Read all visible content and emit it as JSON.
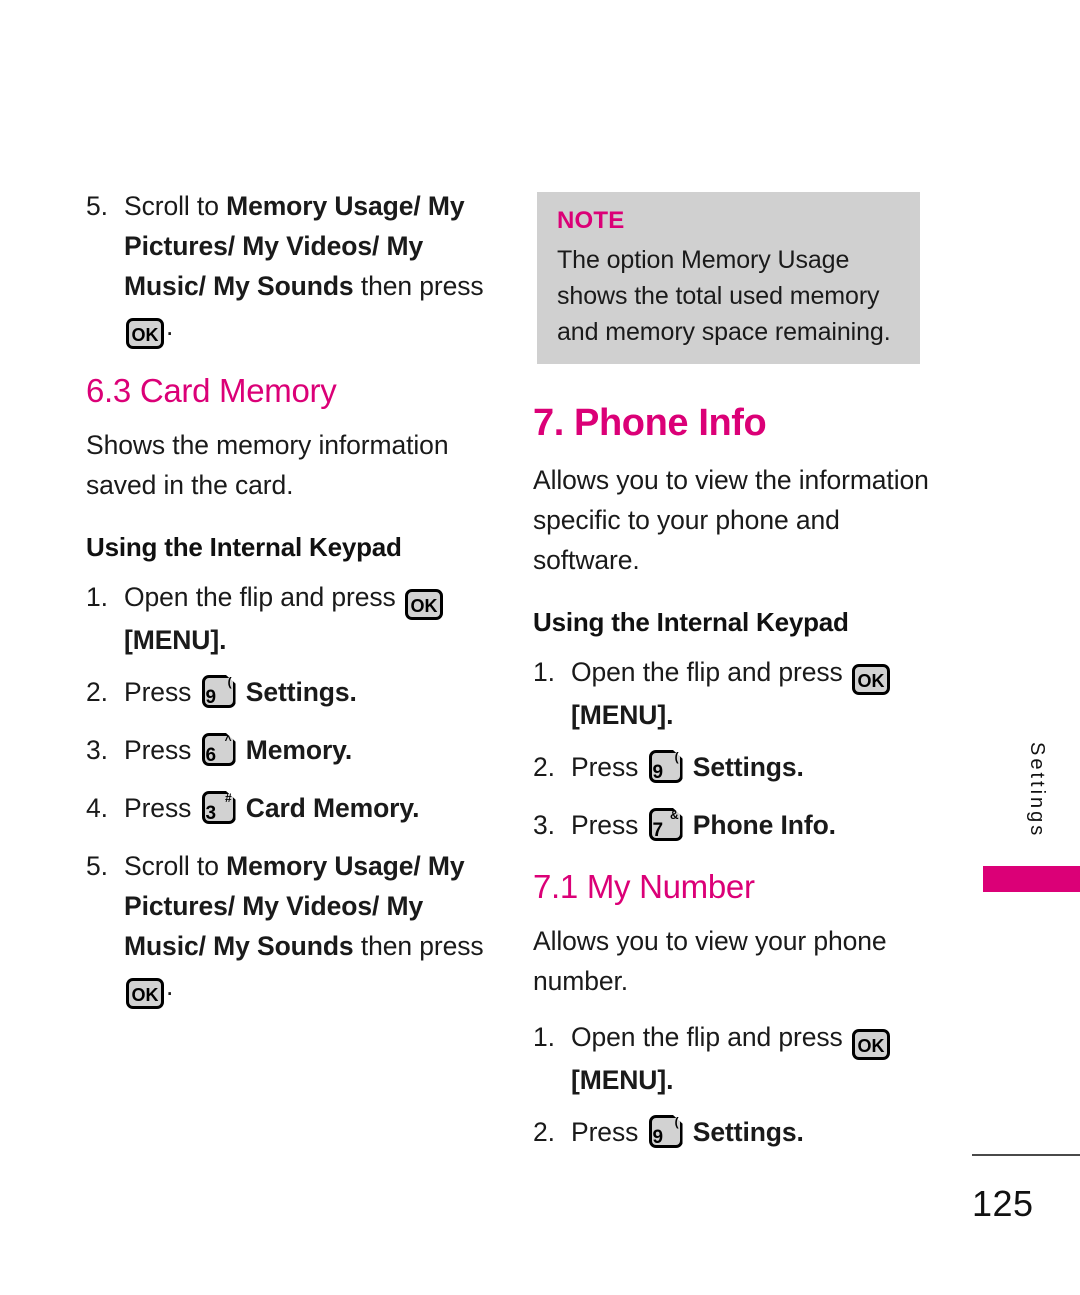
{
  "page": {
    "number": "125",
    "side_tab": "Settings",
    "accent_color": "#DB0077",
    "note_bg": "#d0d0d0"
  },
  "left_column": {
    "step5_top": {
      "num": "5.",
      "pre": "Scroll to ",
      "bold": "Memory Usage/ My Pictures/ My Videos/ My Music/ My Sounds",
      "mid": " then press ",
      "key": "OK",
      "post": "."
    },
    "heading_card_memory": "6.3 Card Memory",
    "intro": "Shows the memory information saved in the card.",
    "subhead_keypad": "Using the Internal Keypad",
    "steps": [
      {
        "num": "1.",
        "pre": "Open the flip and press ",
        "key": "OK",
        "post": " [MENU]."
      },
      {
        "num": "2.",
        "pre": "Press ",
        "key_digit": "9",
        "key_sup": "(",
        "post": " Settings."
      },
      {
        "num": "3.",
        "pre": "Press ",
        "key_digit": "6",
        "key_sup": "^",
        "post": " Memory."
      },
      {
        "num": "4.",
        "pre": "Press ",
        "key_digit": "3",
        "key_sup": "#",
        "post": " Card Memory."
      }
    ],
    "step5_bottom": {
      "num": "5.",
      "pre": "Scroll to ",
      "bold": "Memory Usage/ My Pictures/ My Videos/ My Music/ My Sounds",
      "mid": " then press ",
      "key": "OK",
      "post": "."
    }
  },
  "note": {
    "label": "NOTE",
    "text": "The option Memory Usage shows the total used memory and memory space remaining."
  },
  "right_column": {
    "heading_phone_info": "7. Phone Info",
    "intro": "Allows you to view the information specific to your phone and software.",
    "subhead_keypad": "Using the Internal Keypad",
    "steps": [
      {
        "num": "1.",
        "pre": "Open the flip and press ",
        "key": "OK",
        "post": " [MENU]."
      },
      {
        "num": "2.",
        "pre": "Press ",
        "key_digit": "9",
        "key_sup": "(",
        "post": " Settings."
      },
      {
        "num": "3.",
        "pre": "Press ",
        "key_digit": "7",
        "key_sup": "&",
        "post": " Phone Info."
      }
    ],
    "heading_my_number": "7.1 My Number",
    "my_number_intro": "Allows you to view your phone number.",
    "my_number_steps": [
      {
        "num": "1.",
        "pre": "Open the flip and press ",
        "key": "OK",
        "post": " [MENU]."
      },
      {
        "num": "2.",
        "pre": "Press ",
        "key_digit": "9",
        "key_sup": "(",
        "post": " Settings."
      }
    ]
  }
}
